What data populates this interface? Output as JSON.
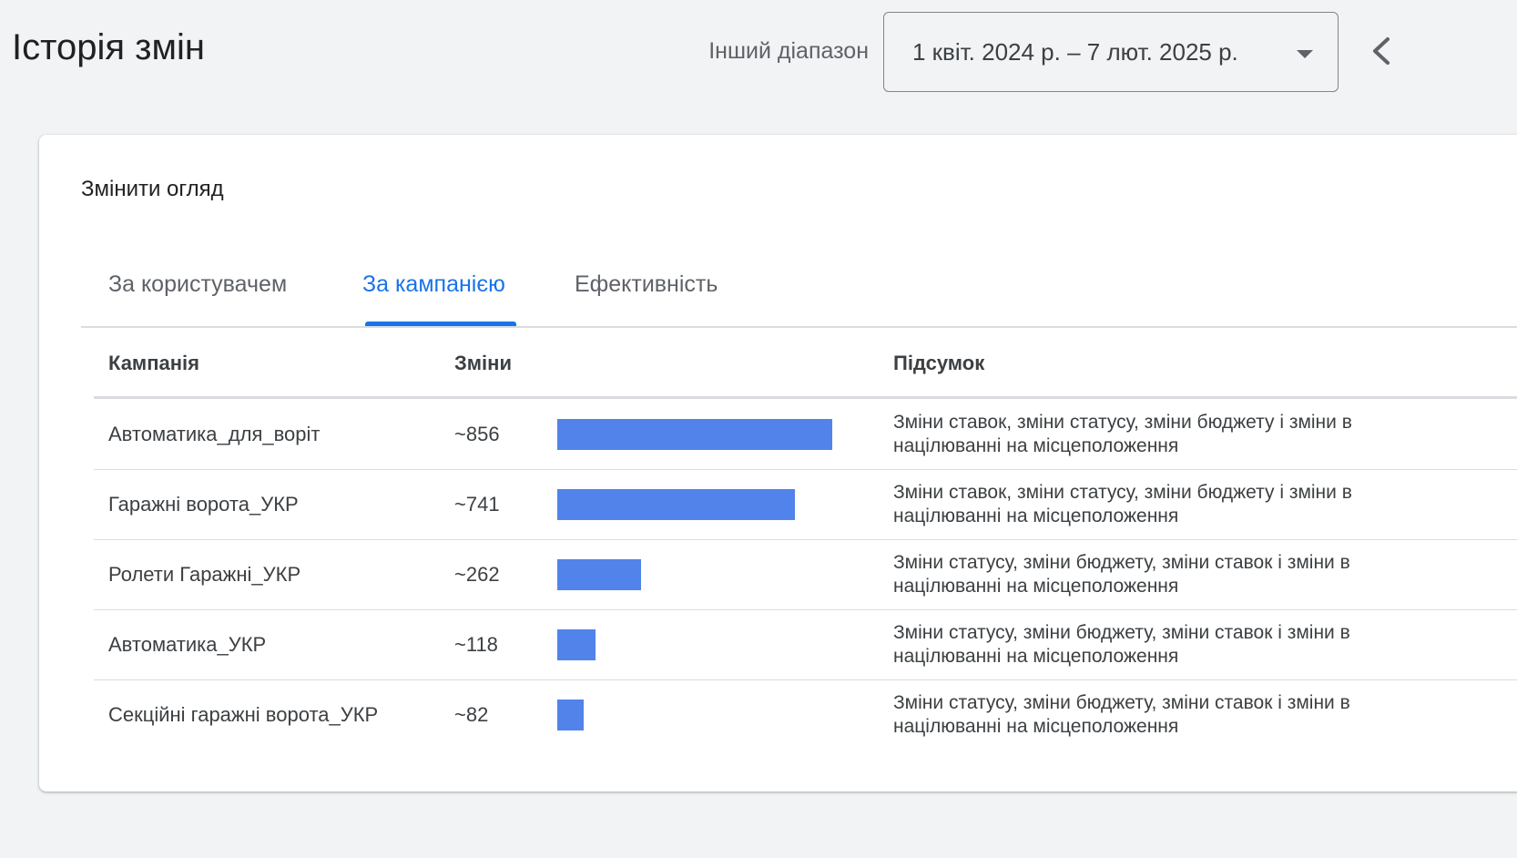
{
  "header": {
    "title": "Історія змін",
    "range_label": "Інший діапазон",
    "range_value": "1 квіт. 2024 р. – 7 лют. 2025 р."
  },
  "card": {
    "title": "Змінити огляд",
    "tabs": [
      {
        "label": "За користувачем",
        "active": false
      },
      {
        "label": "За кампанією",
        "active": true
      },
      {
        "label": "Ефективність",
        "active": false
      }
    ]
  },
  "table": {
    "headers": {
      "campaign": "Кампанія",
      "changes": "Зміни",
      "summary": "Підсумок"
    },
    "bar_color": "#5283ea",
    "rows": [
      {
        "name": "Автоматика_для_воріт",
        "count_label": "~856",
        "count": 856,
        "summary": "Зміни ставок, зміни статусу, зміни бюджету і зміни в націлюванні на місцеположення"
      },
      {
        "name": "Гаражні ворота_УКР",
        "count_label": "~741",
        "count": 741,
        "summary": "Зміни ставок, зміни статусу, зміни бюджету і зміни в націлюванні на місцеположення"
      },
      {
        "name": "Ролети Гаражні_УКР",
        "count_label": "~262",
        "count": 262,
        "summary": "Зміни статусу, зміни бюджету, зміни ставок і зміни в націлюванні на місцеположення"
      },
      {
        "name": "Автоматика_УКР",
        "count_label": "~118",
        "count": 118,
        "summary": "Зміни статусу, зміни бюджету, зміни ставок і зміни в націлюванні на місцеположення"
      },
      {
        "name": "Секційні гаражні ворота_УКР",
        "count_label": "~82",
        "count": 82,
        "summary": "Зміни статусу, зміни бюджету, зміни ставок і зміни в націлюванні на місцеположення"
      }
    ]
  }
}
